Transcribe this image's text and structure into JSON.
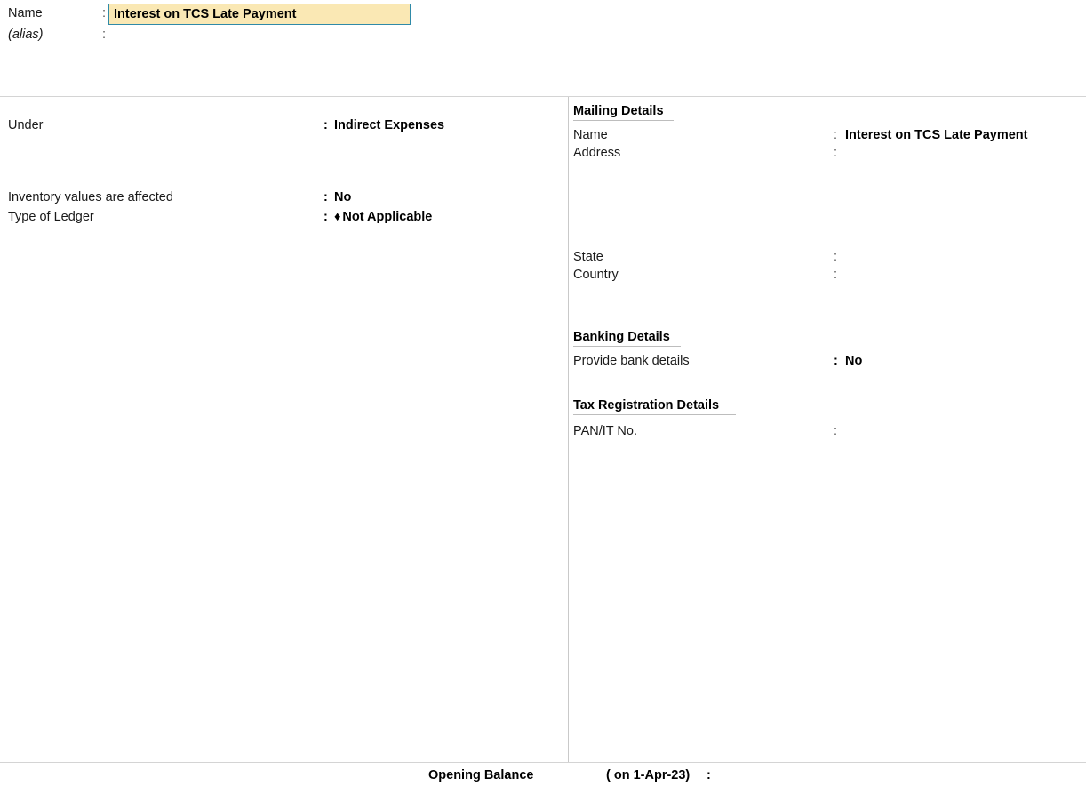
{
  "header": {
    "name_label": "Name",
    "name_colon": ":",
    "name_value": "Interest on TCS Late Payment",
    "alias_label": "(alias)",
    "alias_colon": ":",
    "alias_value": ""
  },
  "left_panel": {
    "rows": [
      {
        "label": "Under",
        "colon": ":",
        "value": "Indirect Expenses",
        "bullet": ""
      },
      {
        "label": "Inventory values are affected",
        "colon": ":",
        "value": "No",
        "bullet": ""
      },
      {
        "label": "Type of Ledger",
        "colon": ":",
        "value": "Not Applicable",
        "bullet": "♦"
      }
    ]
  },
  "right_panel": {
    "mailing": {
      "heading": "Mailing Details",
      "rows": [
        {
          "label": "Name",
          "colon": ":",
          "value": "Interest on TCS Late Payment"
        },
        {
          "label": "Address",
          "colon": ":",
          "value": ""
        },
        {
          "label": "State",
          "colon": ":",
          "value": ""
        },
        {
          "label": "Country",
          "colon": ":",
          "value": ""
        }
      ]
    },
    "banking": {
      "heading": "Banking Details",
      "rows": [
        {
          "label": "Provide bank details",
          "colon": ":",
          "value": "No"
        }
      ]
    },
    "tax": {
      "heading": "Tax Registration Details",
      "rows": [
        {
          "label": "PAN/IT No.",
          "colon": ":",
          "value": ""
        }
      ]
    }
  },
  "footer": {
    "opening_balance_label": "Opening Balance",
    "as_on": "( on 1-Apr-23)",
    "colon": ":",
    "value": ""
  },
  "colors": {
    "field_background": "#fae8b4",
    "field_border": "#2f8aa8",
    "rule": "#d4d4d4"
  }
}
